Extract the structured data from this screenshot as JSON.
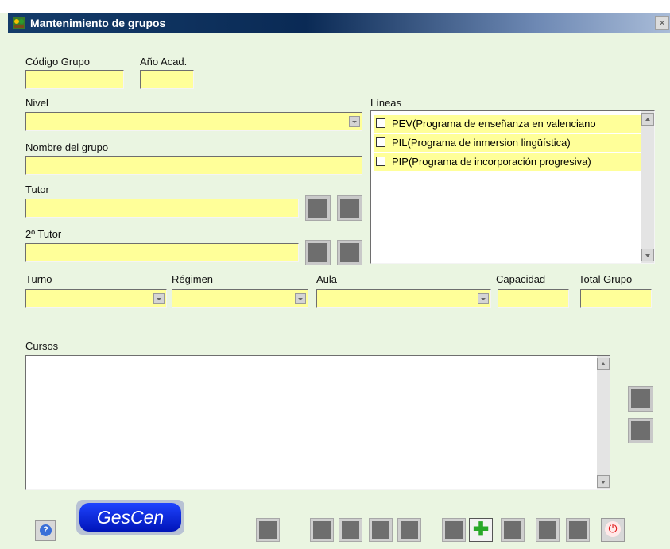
{
  "window": {
    "title": "Mantenimiento de grupos",
    "close_glyph": "×"
  },
  "labels": {
    "codigo_grupo": "Código  Grupo",
    "ano_acad": "Año Acad.",
    "nivel": "Nivel",
    "lineas": "Líneas",
    "nombre_grupo": "Nombre del grupo",
    "tutor": "Tutor",
    "tutor2": "2º Tutor",
    "turno": "Turno",
    "regimen": "Régimen",
    "aula": "Aula",
    "capacidad": "Capacidad",
    "total_grupo": "Total Grupo",
    "cursos": "Cursos"
  },
  "fields": {
    "codigo_grupo": "",
    "ano_acad": "",
    "nivel": "",
    "nombre_grupo": "",
    "tutor": "",
    "tutor2": "",
    "turno": "",
    "regimen": "",
    "aula": "",
    "capacidad": "",
    "total_grupo": ""
  },
  "lineas": [
    {
      "label": "PEV(Programa de enseñanza en valenciano",
      "checked": false
    },
    {
      "label": "PIL(Programa de inmersion lingüística)",
      "checked": false
    },
    {
      "label": "PIP(Programa de incorporación progresiva)",
      "checked": false
    }
  ],
  "logo": {
    "text": "GesCen"
  },
  "toolbar": {
    "add_glyph": "✚"
  },
  "colors": {
    "field_bg": "#ffff99",
    "window_bg": "#eaf5e1",
    "logo_blue": "#0a28e0"
  }
}
